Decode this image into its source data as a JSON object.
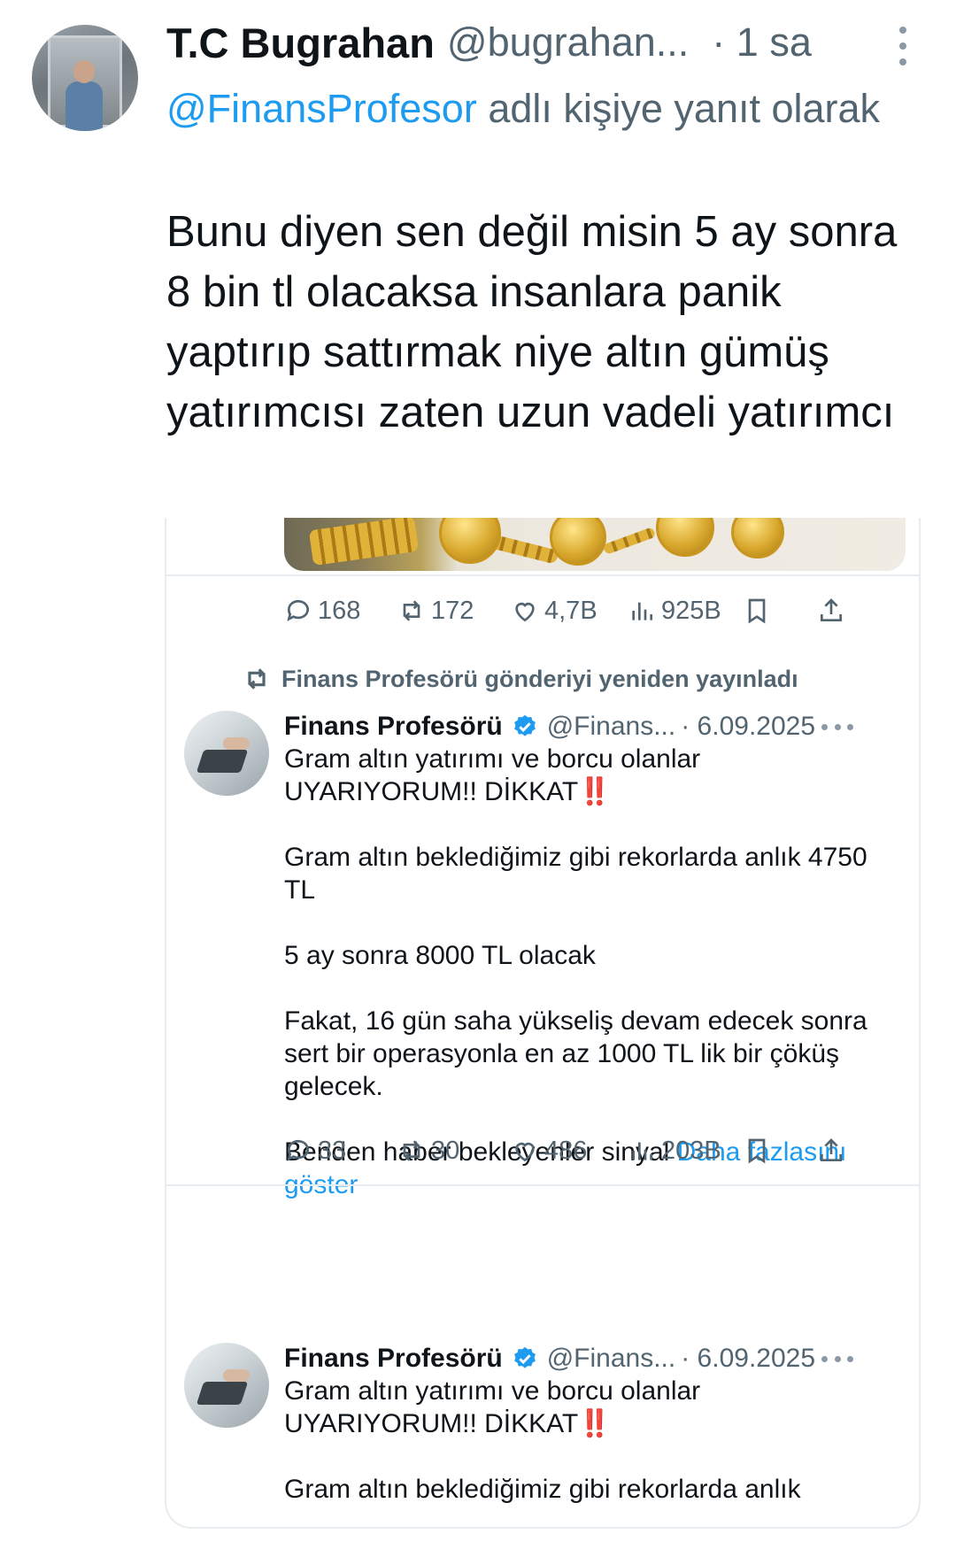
{
  "main_tweet": {
    "author_name": "T.C Bugrahan",
    "author_handle": "@bugrahan...",
    "time": "· 1 sa",
    "reply_mention": "@FinansProfesor",
    "reply_suffix": " adlı kişiye yanıt olarak",
    "text": "Bunu diyen sen değil misin 5 ay sonra 8 bin tl olacaksa insanlara panik yaptırıp sattırmak niye altın gümüş yatırımcısı zaten uzun vadeli yatırımcı"
  },
  "card": {
    "first_post_actions": {
      "replies": "168",
      "reposts": "172",
      "likes": "4,7B",
      "views": "925B"
    },
    "repost_notice": "Finans Profesörü gönderiyi yeniden yayınladı",
    "post": {
      "author_name": "Finans Profesörü",
      "author_handle": "@Finans...",
      "date": "· 6.09.2025",
      "line1": "Gram altın yatırımı ve borcu olanlar",
      "line2": "UYARIYORUM!! DİKKAT",
      "line2_emoji": "‼️",
      "para2": "Gram altın beklediğimiz gibi rekorlarda anlık 4750 TL",
      "para3": "5 ay sonra 8000 TL olacak",
      "para4": "Fakat, 16 gün saha yükseliş devam edecek sonra sert bir operasyonla en az 1000 TL lik bir çöküş gelecek.",
      "para5": "Benden haber bekleyenler sinyal ",
      "show_more": "Daha fazlasını göster",
      "actions": {
        "replies": "33",
        "reposts": "30",
        "likes": "486",
        "views": "203B"
      }
    },
    "post2": {
      "author_name": "Finans Profesörü",
      "author_handle": "@Finans...",
      "date": "· 6.09.2025",
      "line1": "Gram altın yatırımı ve borcu olanlar",
      "line2": "UYARIYORUM!! DİKKAT",
      "line2_emoji": "‼️",
      "para2": "Gram altın beklediğimiz gibi rekorlarda anlık"
    }
  },
  "colors": {
    "link": "#1d9bf0",
    "muted": "#536471",
    "text": "#0f1419",
    "verified": "#1d9bf0",
    "alert_red": "#e0241b"
  },
  "icons": [
    "reply-icon",
    "repost-icon",
    "like-icon",
    "views-icon",
    "bookmark-icon",
    "share-icon",
    "verified-badge-icon",
    "more-icon"
  ]
}
